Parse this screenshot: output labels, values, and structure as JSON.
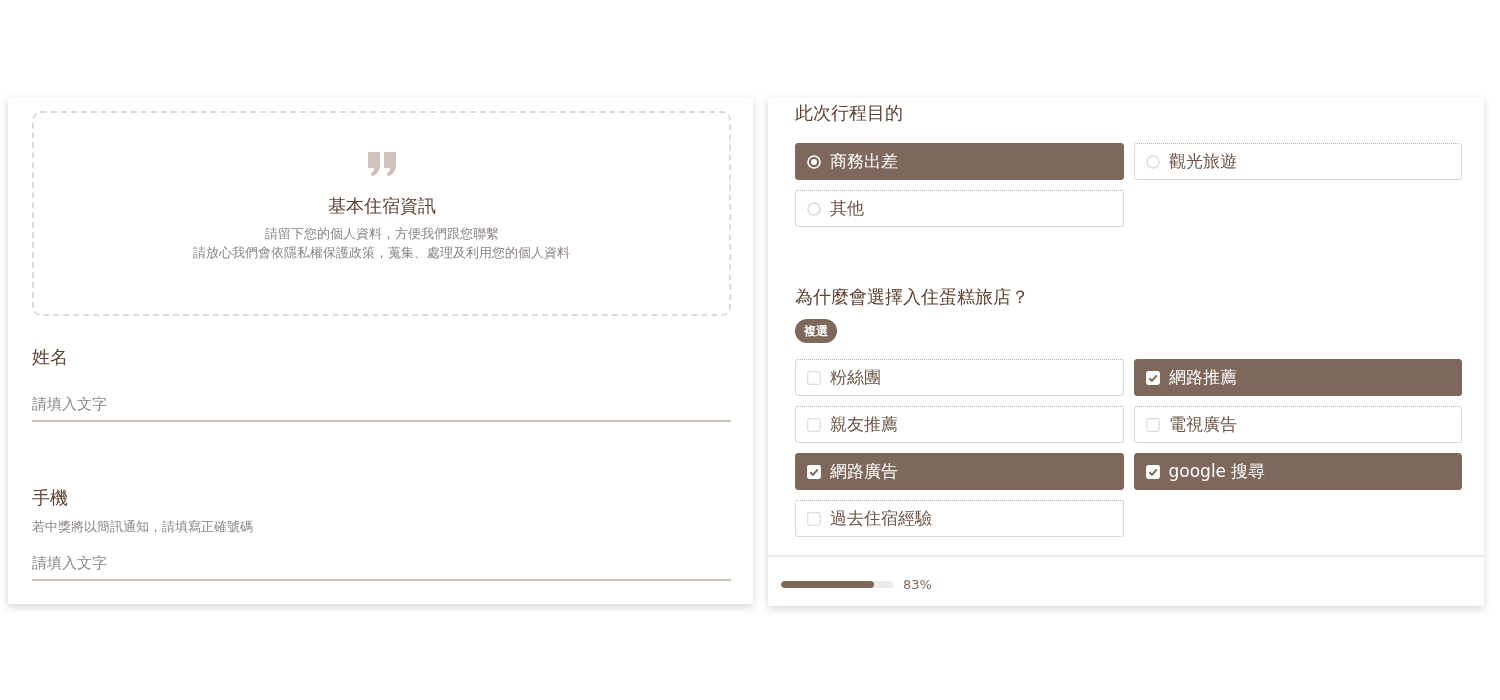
{
  "info_card": {
    "title": "基本住宿資訊",
    "lines": [
      "請留下您的個人資料，方便我們跟您聯繫",
      "請放心我們會依隱私權保護政策，蒐集、處理及利用您的個人資料"
    ]
  },
  "fields": [
    {
      "label": "姓名",
      "placeholder": "請填入文字"
    },
    {
      "label": "手機",
      "hint": "若中獎將以簡訊通知，請填寫正確號碼",
      "placeholder": "請填入文字"
    }
  ],
  "questions": [
    {
      "kind": "radio",
      "title": "此次行程目的",
      "options": [
        {
          "label": "商務出差",
          "selected": true
        },
        {
          "label": "觀光旅遊",
          "selected": false
        },
        {
          "label": "其他",
          "selected": false
        }
      ]
    },
    {
      "kind": "checkbox",
      "title": "為什麼會選擇入住蛋糕旅店？",
      "badge": "複選",
      "options": [
        {
          "label": "粉絲團",
          "checked": false
        },
        {
          "label": "網路推薦",
          "checked": true
        },
        {
          "label": "親友推薦",
          "checked": false
        },
        {
          "label": "電視廣告",
          "checked": false
        },
        {
          "label": "網路廣告",
          "checked": true
        },
        {
          "label": "google 搜尋",
          "checked": true
        },
        {
          "label": "過去住宿經驗",
          "checked": false
        }
      ]
    }
  ],
  "progress": {
    "level": 0.83,
    "reading": "83%"
  }
}
